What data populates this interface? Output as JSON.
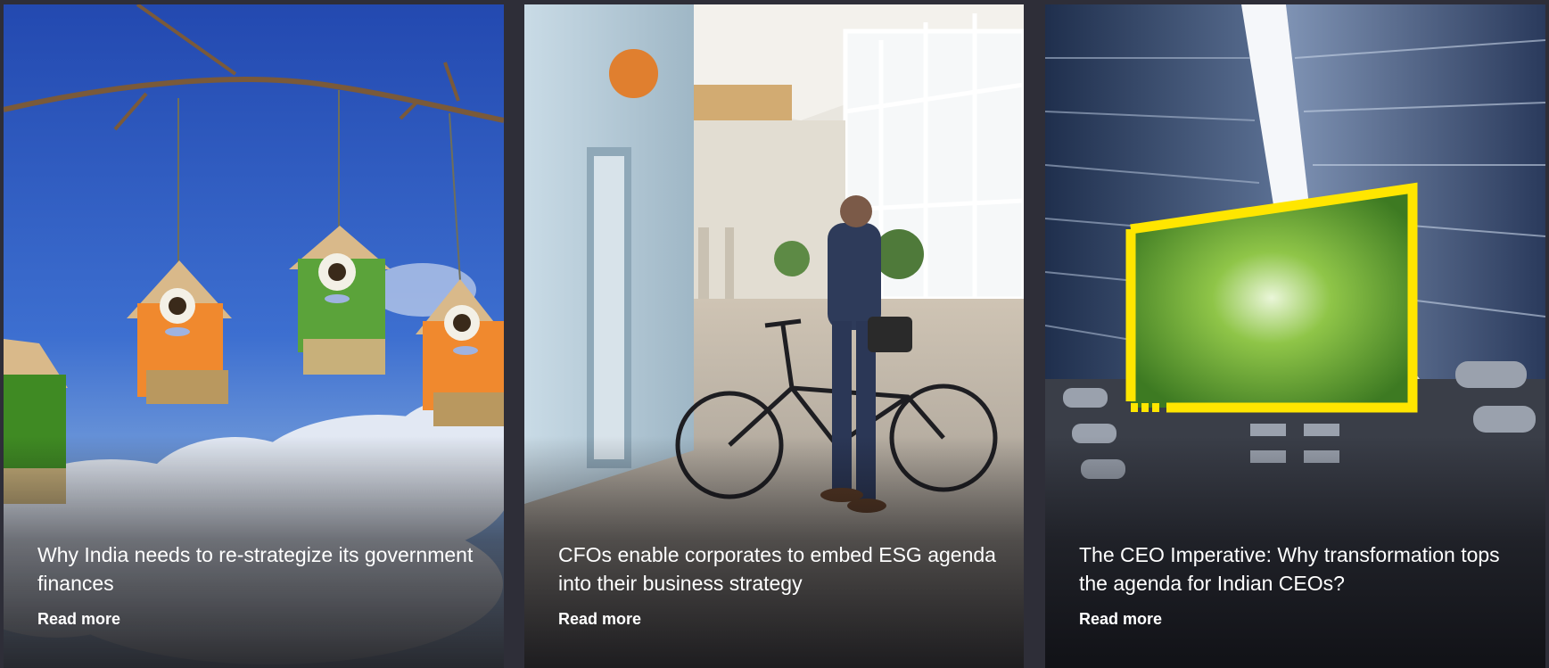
{
  "cards": [
    {
      "title": "Why India needs to re-strategize its government finances",
      "link_label": "Read more",
      "image": "birdhouses-on-branch"
    },
    {
      "title": "CFOs enable corporates to embed ESG agenda into their business strategy",
      "link_label": "Read more",
      "image": "businessman-with-bicycle-in-office-corridor"
    },
    {
      "title": "The CEO Imperative: Why transformation tops the agenda for Indian CEOs?",
      "link_label": "Read more",
      "image": "skyscrapers-with-yellow-frame-trees"
    }
  ],
  "colors": {
    "page_background": "#2e2e38",
    "text": "#ffffff",
    "accent_yellow": "#ffe600"
  }
}
